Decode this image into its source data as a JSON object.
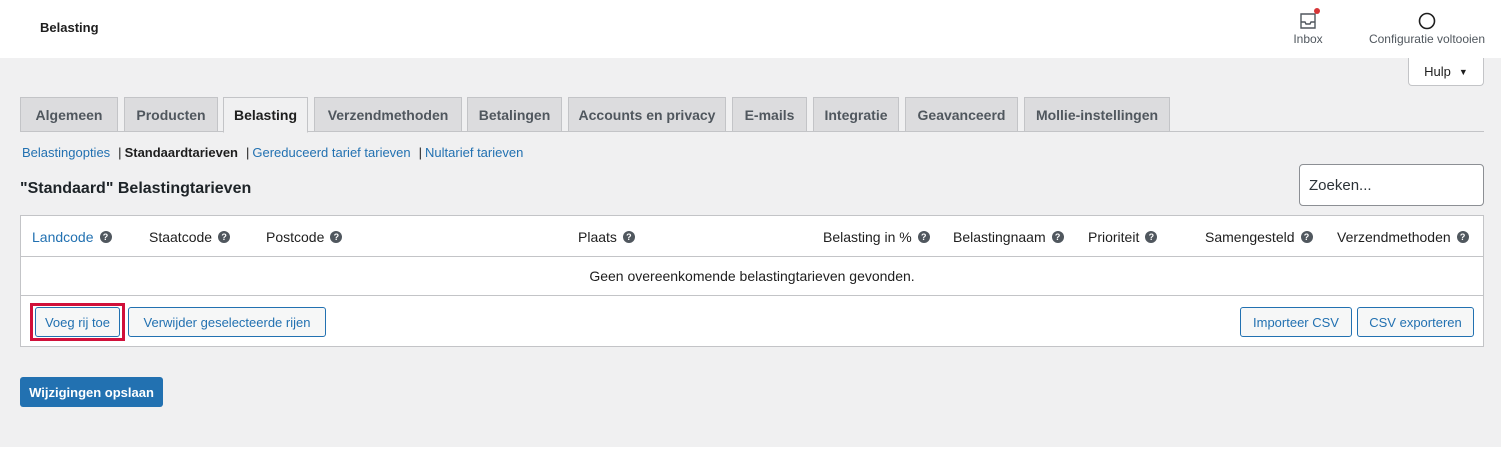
{
  "header": {
    "title": "Belasting"
  },
  "top_actions": {
    "inbox": "Inbox",
    "config": "Configuratie voltooien"
  },
  "help": {
    "label": "Hulp"
  },
  "tabs": [
    {
      "label": "Algemeen"
    },
    {
      "label": "Producten"
    },
    {
      "label": "Belasting",
      "active": true
    },
    {
      "label": "Verzendmethoden"
    },
    {
      "label": "Betalingen"
    },
    {
      "label": "Accounts en privacy"
    },
    {
      "label": "E-mails"
    },
    {
      "label": "Integratie"
    },
    {
      "label": "Geavanceerd"
    },
    {
      "label": "Mollie-instellingen"
    }
  ],
  "subnav": {
    "options": "Belastingopties",
    "sep1": "|",
    "standard": "Standaardtarieven",
    "sep2": "|",
    "reduced": "Gereduceerd tarief tarieven",
    "sep3": "|",
    "zero": "Nultarief tarieven"
  },
  "page": {
    "heading": "\"Standaard\" Belastingtarieven"
  },
  "search": {
    "placeholder": "Zoeken..."
  },
  "table": {
    "columns": [
      {
        "label": "Landcode",
        "link": true
      },
      {
        "label": "Staatcode"
      },
      {
        "label": "Postcode"
      },
      {
        "label": "Plaats"
      },
      {
        "label": "Belasting in %"
      },
      {
        "label": "Belastingnaam"
      },
      {
        "label": "Prioriteit"
      },
      {
        "label": "Samengesteld"
      },
      {
        "label": "Verzendmethoden"
      }
    ],
    "help_glyph": "?",
    "empty_message": "Geen overeenkomende belastingtarieven gevonden."
  },
  "actions": {
    "add_row": "Voeg rij toe",
    "remove_rows": "Verwijder geselecteerde rijen",
    "import_csv": "Importeer CSV",
    "export_csv": "CSV exporteren"
  },
  "save": {
    "label": "Wijzigingen opslaan"
  },
  "colors": {
    "accent": "#2271b1",
    "highlight": "#d0103a",
    "notification": "#d63638"
  }
}
